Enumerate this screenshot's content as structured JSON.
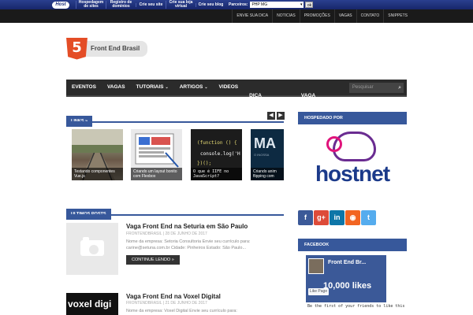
{
  "topbar": {
    "logo_text": "Host",
    "links": [
      "Hospedagem de sites",
      "Registro de domínios",
      "Crie seu site",
      "Crie sua loja virtual",
      "Crie seu blog"
    ],
    "partners_label": "Parceiros:",
    "select_value": "PHP MG",
    "ok_label": "ok"
  },
  "subnav": [
    "ENVIE SUA DICA",
    "NOTICIAS",
    "PROMOÇÕES",
    "VAGAS",
    "CONTATO",
    "SNIPPETS"
  ],
  "logo": {
    "shield_text": "5",
    "name": "Front End Brasil"
  },
  "mainnav": {
    "items": [
      {
        "label": "EVENTOS",
        "caret": ""
      },
      {
        "label": "VAGAS",
        "caret": ""
      },
      {
        "label": "TUTORIAIS",
        "caret": "⌄"
      },
      {
        "label": "ARTIGOS",
        "caret": "⌄"
      },
      {
        "label": "VIDEOS",
        "caret": ""
      },
      {
        "label": "ENVIE SUA DICA",
        "caret": ""
      },
      {
        "label": "ANUNCIAR VAGA",
        "caret": ""
      }
    ],
    "search_placeholder": "Pesquisar"
  },
  "links_section": {
    "header": "LINKS »",
    "prev": "◀",
    "next": "▶",
    "cards": [
      {
        "caption": "Testando componentes Vue.js"
      },
      {
        "caption": "Criando um layout bonito com Flexbox"
      },
      {
        "caption": "O que é IIFE no JavaScript?",
        "code1": "(function () {",
        "code2": "console.log('H",
        "code3": "})();"
      },
      {
        "caption": "Criando anim flipping com",
        "badge": "MA",
        "sub": "O INOSSA"
      }
    ]
  },
  "sidebar": {
    "hosted_header": "HOSPEDADO POR",
    "hosted_logo": "hostnet",
    "social": [
      {
        "icon": "facebook-icon",
        "glyph": "f",
        "color": "#3b5998"
      },
      {
        "icon": "google-plus-icon",
        "glyph": "g+",
        "color": "#dd4b39"
      },
      {
        "icon": "linkedin-icon",
        "glyph": "in",
        "color": "#0e76a8"
      },
      {
        "icon": "rss-icon",
        "glyph": "◉",
        "color": "#f26522"
      },
      {
        "icon": "twitter-icon",
        "glyph": "t",
        "color": "#55acee"
      }
    ],
    "facebook_header": "FACEBOOK",
    "fb_page_name": "Front End Br...",
    "fb_likes": "10,000 likes",
    "fb_like_button": "Like Page",
    "fb_text": "Be the first of your friends to like this"
  },
  "posts_section": {
    "header": "ULTIMOS POSTS",
    "posts": [
      {
        "title": "Vaga Front End na Seturia em São Paulo",
        "meta": "FRONTENDBRASIL | 28 DE JUNHO DE 2017",
        "excerpt": "Nome da empresa: Setoria Consultoria Envie seu currículo para: carine@setuna.com.br Cidade: Pinheiros Estado: São Paulo...",
        "more": "CONTINUE LENDO »"
      },
      {
        "title": "Vaga Front End na Voxel Digital",
        "meta": "FRONTENDBRASIL | 21 DE JUNHO DE 2017",
        "excerpt": "Nome da empresa: Voxel Digital Envie seu currículo para:",
        "thumb_text": "voxel digi"
      }
    ]
  }
}
